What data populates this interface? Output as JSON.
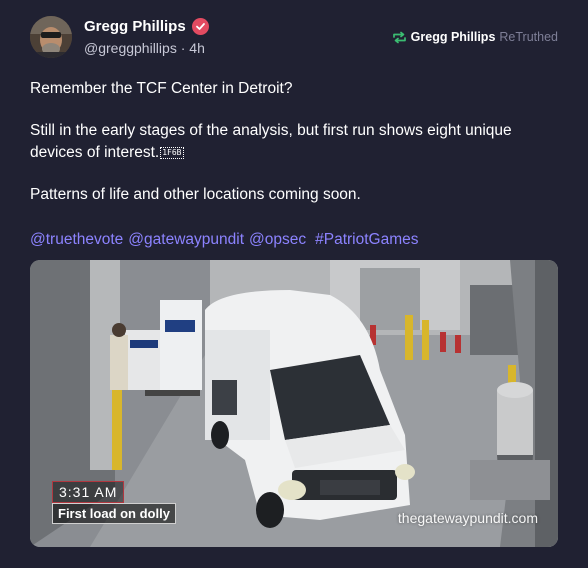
{
  "post": {
    "author": {
      "display_name": "Gregg Phillips",
      "handle": "@greggphillips",
      "separator": "·",
      "time": "4h",
      "avatar_icon": "avatar",
      "verified_icon": "verified-badge-icon",
      "verified_color": "#e34b61"
    },
    "retruth": {
      "name": "Gregg Phillips",
      "label": "ReTruthed",
      "icon": "retruth-icon",
      "icon_color": "#3bbd72"
    },
    "paragraphs": [
      "Remember the TCF Center in Detroit?",
      "Still in the early stages of the analysis, but first run shows eight unique devices of interest.",
      "Patterns of life and other locations coming soon."
    ],
    "emoji_glyph": "1F6B",
    "tags": [
      "@truethevote",
      "@gatewaypundit",
      "@opsec",
      "#PatriotGames"
    ],
    "media": {
      "timestamp": "3:31 AM",
      "caption": "First load on dolly",
      "watermark": "thegatewaypundit.com"
    },
    "colors": {
      "background": "#202132",
      "link": "#8c83ff",
      "muted": "#7e7f97"
    }
  }
}
